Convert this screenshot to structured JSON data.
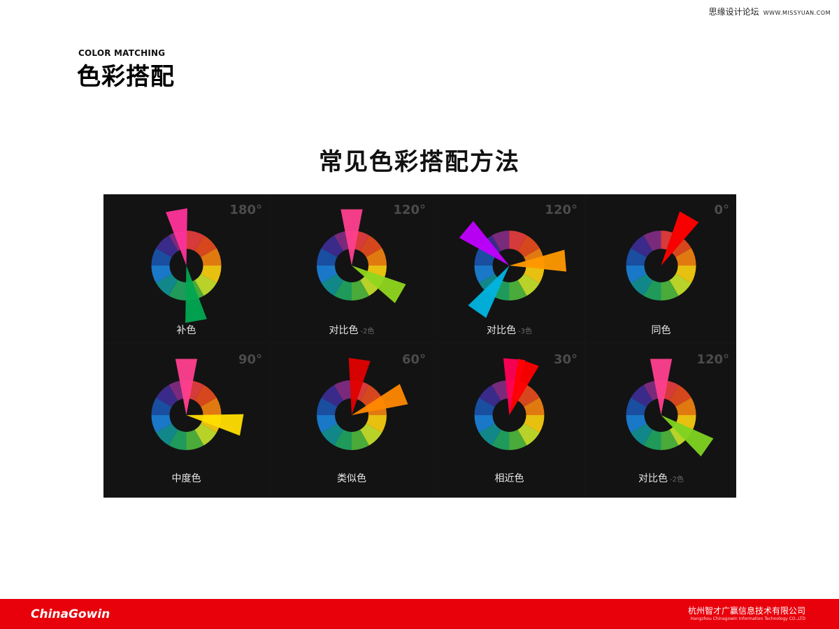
{
  "watermark": {
    "cn": "思缘设计论坛",
    "url": "WWW.MISSYUAN.COM"
  },
  "header": {
    "subtitle": "COLOR MATCHING",
    "title": "色彩搭配"
  },
  "heading": "常见色彩搭配方法",
  "panels": [
    {
      "angle": "180°",
      "label": "补色",
      "note": "",
      "pointers": [
        {
          "deg": -10,
          "color": "#ff3399"
        },
        {
          "deg": 170,
          "color": "#00a651"
        }
      ]
    },
    {
      "angle": "120°",
      "label": "对比色",
      "note": "-2色",
      "pointers": [
        {
          "deg": 0,
          "color": "#ff3f8e"
        },
        {
          "deg": 120,
          "color": "#8fd61f"
        }
      ]
    },
    {
      "angle": "120°",
      "label": "对比色",
      "note": "-3色",
      "pointers": [
        {
          "deg": -50,
          "color": "#c000ff"
        },
        {
          "deg": 85,
          "color": "#ff9900"
        },
        {
          "deg": 215,
          "color": "#00b4e0"
        }
      ]
    },
    {
      "angle": "0°",
      "label": "同色",
      "note": "",
      "pointers": [
        {
          "deg": 30,
          "color": "#8b0000"
        },
        {
          "deg": 30,
          "color": "#ff0000"
        }
      ]
    },
    {
      "angle": "90°",
      "label": "中度色",
      "note": "",
      "pointers": [
        {
          "deg": 0,
          "color": "#ff3f8e"
        },
        {
          "deg": 100,
          "color": "#ffdd00"
        }
      ]
    },
    {
      "angle": "60°",
      "label": "类似色",
      "note": "",
      "pointers": [
        {
          "deg": 8,
          "color": "#e00000"
        },
        {
          "deg": 68,
          "color": "#ff8800"
        }
      ]
    },
    {
      "angle": "30°",
      "label": "相近色",
      "note": "",
      "pointers": [
        {
          "deg": 5,
          "color": "#ff0055"
        },
        {
          "deg": 20,
          "color": "#ff0000"
        }
      ]
    },
    {
      "angle": "120°",
      "label": "对比色",
      "note": "-2色",
      "pointers": [
        {
          "deg": 0,
          "color": "#ff3f8e"
        },
        {
          "deg": 125,
          "color": "#7ed321"
        }
      ]
    }
  ],
  "wheel_colors": [
    "#d63a3a",
    "#d6471d",
    "#e07a10",
    "#e8c010",
    "#b8d22a",
    "#4aaa3a",
    "#1f9a5a",
    "#12878a",
    "#1a78c8",
    "#1a4ea0",
    "#3a2a8a",
    "#7a2a7a"
  ],
  "footer": {
    "brand": "ChinaGowin",
    "company_cn": "杭州智才广赢信息技术有限公司",
    "company_en": "Hangzhou Chinagowin Information Technology CO.,LTD"
  }
}
